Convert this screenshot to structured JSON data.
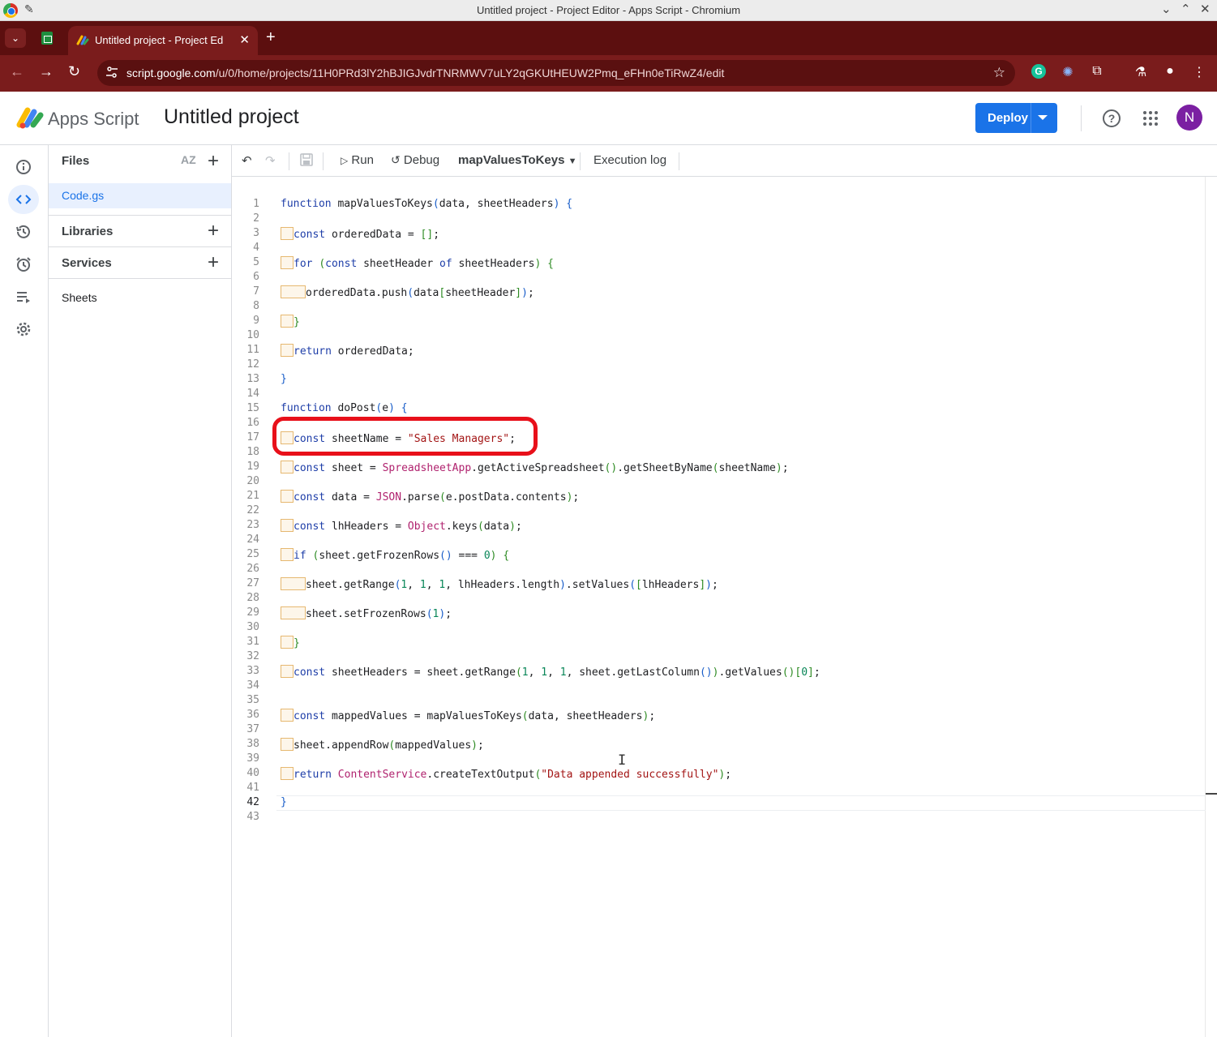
{
  "window": {
    "title": "Untitled project - Project Editor - Apps Script - Chromium"
  },
  "tab": {
    "label": "Untitled project - Project Ed",
    "close": "✕",
    "new_tab": "+"
  },
  "address": {
    "domain": "script.google.com",
    "path": "/u/0/home/projects/11H0PRd3lY2hBJIGJvdrTNRMWV7uLY2qGKUtHEUW2Pmq_eFHn0eTiRwZ4/edit"
  },
  "header": {
    "product": "Apps Script",
    "project_title": "Untitled project",
    "deploy_label": "Deploy",
    "avatar_letter": "N"
  },
  "files_panel": {
    "files_header": "Files",
    "sort_label": "AZ",
    "file": "Code.gs",
    "libraries": "Libraries",
    "services": "Services",
    "service_item": "Sheets"
  },
  "toolbar": {
    "run": "Run",
    "debug": "Debug",
    "function_select": "mapValuesToKeys",
    "execution_log": "Execution log"
  },
  "code": [
    {
      "n": "1",
      "text": "function mapValuesToKeys(data, sheetHeaders) {"
    },
    {
      "n": "2",
      "text": ""
    },
    {
      "n": "3",
      "text": "const orderedData = [];"
    },
    {
      "n": "4",
      "text": ""
    },
    {
      "n": "5",
      "text": "for (const sheetHeader of sheetHeaders) {"
    },
    {
      "n": "6",
      "text": ""
    },
    {
      "n": "7",
      "text": "orderedData.push(data[sheetHeader]);"
    },
    {
      "n": "8",
      "text": ""
    },
    {
      "n": "9",
      "text": "}"
    },
    {
      "n": "10",
      "text": ""
    },
    {
      "n": "11",
      "text": "return orderedData;"
    },
    {
      "n": "12",
      "text": ""
    },
    {
      "n": "13",
      "text": "}"
    },
    {
      "n": "14",
      "text": ""
    },
    {
      "n": "15",
      "text": "function doPost(e) {"
    },
    {
      "n": "16",
      "text": ""
    },
    {
      "n": "17",
      "text": "const sheetName = \"Sales Managers\";"
    },
    {
      "n": "18",
      "text": ""
    },
    {
      "n": "19",
      "text": "const sheet = SpreadsheetApp.getActiveSpreadsheet().getSheetByName(sheetName);"
    },
    {
      "n": "20",
      "text": ""
    },
    {
      "n": "21",
      "text": "const data = JSON.parse(e.postData.contents);"
    },
    {
      "n": "22",
      "text": ""
    },
    {
      "n": "23",
      "text": "const lhHeaders = Object.keys(data);"
    },
    {
      "n": "24",
      "text": ""
    },
    {
      "n": "25",
      "text": "if (sheet.getFrozenRows() === 0) {"
    },
    {
      "n": "26",
      "text": ""
    },
    {
      "n": "27",
      "text": "sheet.getRange(1, 1, 1, lhHeaders.length).setValues([lhHeaders]);"
    },
    {
      "n": "28",
      "text": ""
    },
    {
      "n": "29",
      "text": "sheet.setFrozenRows(1);"
    },
    {
      "n": "30",
      "text": ""
    },
    {
      "n": "31",
      "text": "}"
    },
    {
      "n": "32",
      "text": ""
    },
    {
      "n": "33",
      "text": "const sheetHeaders = sheet.getRange(1, 1, 1, sheet.getLastColumn()).getValues()[0];"
    },
    {
      "n": "34",
      "text": ""
    },
    {
      "n": "35",
      "text": ""
    },
    {
      "n": "36",
      "text": "const mappedValues = mapValuesToKeys(data, sheetHeaders);"
    },
    {
      "n": "37",
      "text": ""
    },
    {
      "n": "38",
      "text": "sheet.appendRow(mappedValues);"
    },
    {
      "n": "39",
      "text": ""
    },
    {
      "n": "40",
      "text": "return ContentService.createTextOutput(\"Data appended successfully\");"
    },
    {
      "n": "41",
      "text": ""
    },
    {
      "n": "42",
      "text": "}"
    },
    {
      "n": "43",
      "text": ""
    }
  ],
  "colors": {
    "browser_frame": "#7a1c1c",
    "accent": "#1a73e8",
    "highlight": "#e8101a"
  }
}
